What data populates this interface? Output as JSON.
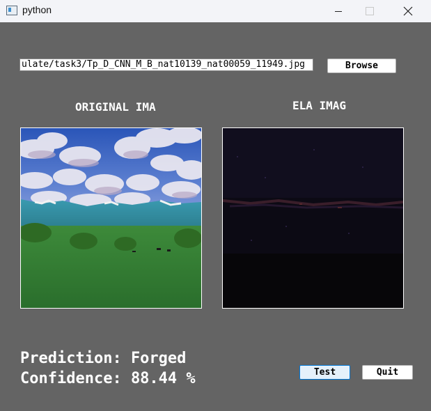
{
  "window": {
    "title": "python"
  },
  "form": {
    "path_value": "ulate/task3/Tp_D_CNN_M_B_nat10139_nat00059_11949.jpg",
    "browse_label": "Browse"
  },
  "images": {
    "original_label": "ORIGINAL IMA",
    "ela_label": "ELA IMAG"
  },
  "results": {
    "prediction_text": "Prediction: Forged",
    "confidence_text": "Confidence: 88.44 %"
  },
  "buttons": {
    "test_label": "Test",
    "quit_label": "Quit"
  }
}
